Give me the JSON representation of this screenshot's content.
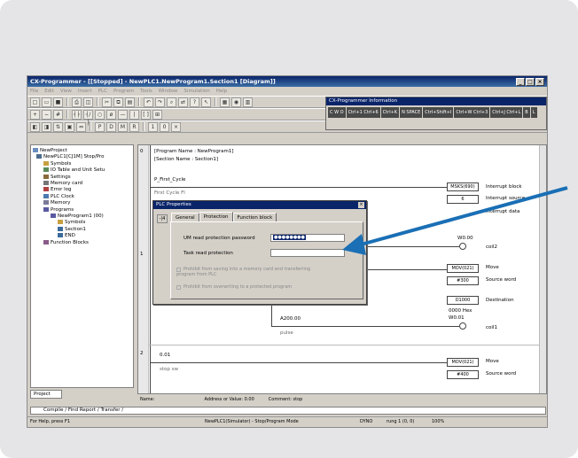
{
  "window": {
    "title": "CX-Programmer - [[Stopped] - NewPLC1.NewProgram1.Section1 [Diagram]]"
  },
  "menu": [
    "File",
    "Edit",
    "View",
    "Insert",
    "PLC",
    "Program",
    "Tools",
    "Window",
    "Simulation",
    "Help"
  ],
  "info_panel": {
    "title": "CX-Programmer Information",
    "items": [
      "C W O",
      "Ctrl+1 Ctrl+6",
      "Ctrl+K",
      "N SPACE",
      "Ctrl+Shift+I",
      "Ctrl+W Ctrl+3",
      "Ctrl+J Ctrl+L",
      "B",
      "L"
    ]
  },
  "tree": {
    "items": [
      "NewProject",
      "NewPLC1[CJ1M] Stop/Pro",
      "Symbols",
      "IO Table and Unit Setu",
      "Settings",
      "Memory card",
      "Error log",
      "PLC Clock",
      "Memory",
      "Programs",
      "NewProgram1 (00)",
      "Symbols",
      "Section1",
      "END",
      "Function Blocks"
    ],
    "tab_label": "Project"
  },
  "ladder": {
    "program_name": "[Program Name : NewProgram1]",
    "section_name": "[Section Name : Section1]",
    "rungs": [
      "0",
      "1",
      "2"
    ],
    "contact_first_cycle": "P_First_Cycle",
    "contact_first_cycle_desc": "First Cycle Fl",
    "interrupt_box": "MSKS(690)",
    "interrupt_box_val": "6",
    "interrupt_labels": [
      "Interrupt block",
      "Interrupt source",
      "Interrupt data"
    ],
    "w000": "W0.00",
    "w000_desc": "coil2",
    "mov_box": "MOV(021)",
    "mov_source": "#300",
    "mov_dest": "D1000",
    "mov_labels": [
      "Move",
      "Source word",
      "Destination"
    ],
    "hex_val": "0000 Hex",
    "w001": "W0.01",
    "w001_desc": "coil1",
    "a20000": "A200.00",
    "a20000_desc": "pulse",
    "rung2_contact": "0.01",
    "rung2_contact_desc": "stop sw",
    "mov2_box": "MOV(021)",
    "mov2_source": "#400",
    "mov2_labels": [
      "Move",
      "Source word"
    ]
  },
  "dialog": {
    "title": "PLC Properties",
    "pin": "-|4",
    "tabs": [
      "General",
      "Protection",
      "Function block"
    ],
    "active_tab": "Protection",
    "um_label": "UM read protection password",
    "um_value": "●●●●●●●●",
    "task_label": "Task read protection",
    "task_value": "",
    "chk1": "Prohibit from saving into a memory card and transferring program from PLC",
    "chk2": "Prohibit from overwriting to a protected program"
  },
  "bottom": {
    "name_label": "Name:",
    "address_label": "Address or Value: 0.00",
    "comment_label": "Comment: stop"
  },
  "output_tabs": "Compile / Find Report / Transfer /",
  "statusbar": {
    "help": "For Help, press F1",
    "plc": "NewPLC1(Simulator) - Stop/Program Mode",
    "mode": "DYNO",
    "pos": "rung 1 (0, 0)",
    "zoom": "100%"
  },
  "colors": {
    "card_bg": "#e5e5e7",
    "arrow": "#1a6fb5",
    "titlebar": "#0a246a"
  }
}
